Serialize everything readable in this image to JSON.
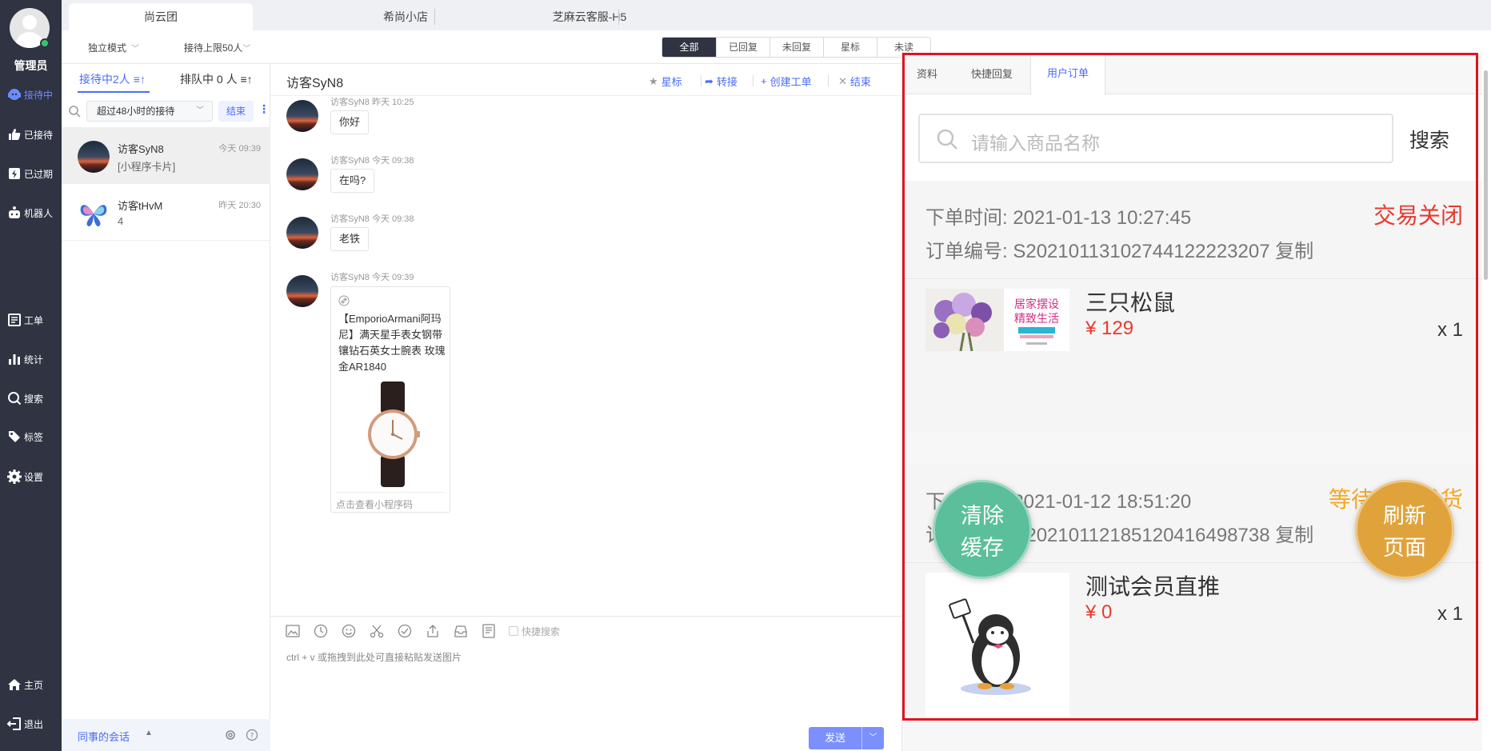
{
  "nav": {
    "user_name": "管理员",
    "items": [
      {
        "label": "接待中"
      },
      {
        "label": "已接待"
      },
      {
        "label": "已过期"
      },
      {
        "label": "机器人"
      },
      {
        "label": "工单"
      },
      {
        "label": "统计"
      },
      {
        "label": "搜索"
      },
      {
        "label": "标签"
      },
      {
        "label": "设置"
      },
      {
        "label": "主页"
      },
      {
        "label": "退出"
      }
    ]
  },
  "top_tabs": [
    "尚云团",
    "希尚小店",
    "芝麻云客服-H5"
  ],
  "mode_bar": {
    "mode": "独立模式",
    "limit": "接待上限50人",
    "filters": [
      "全部",
      "已回复",
      "未回复",
      "星标",
      "未读"
    ]
  },
  "session_list": {
    "tab_active": "接待中2人",
    "tab_queue": "排队中 0 人",
    "filter_select": "超过48小时的接待",
    "end_button": "结束",
    "more": "⋮",
    "sessions": [
      {
        "name": "访客SyN8",
        "time": "今天 09:39",
        "message": "[小程序卡片]"
      },
      {
        "name": "访客tHvM",
        "time": "昨天 20:30",
        "message": "4"
      }
    ],
    "footer_label": "同事的会话"
  },
  "chat": {
    "title": "访客SyN8",
    "actions": {
      "star": "星标",
      "transfer": "转接",
      "ticket": "创建工单",
      "end": "结束"
    },
    "messages": [
      {
        "meta": "访客SyN8   昨天 10:25",
        "text": "你好"
      },
      {
        "meta": "访客SyN8   今天 09:38",
        "text": "在吗?"
      },
      {
        "meta": "访客SyN8   今天 09:38",
        "text": "老铁"
      },
      {
        "meta": "访客SyN8   今天 09:39"
      }
    ],
    "card": {
      "text": "【EmporioArmani阿玛尼】满天星手表女钢带镶钻石英女士腕表 玫瑰金AR1840",
      "footer": "点击查看小程序码"
    },
    "quick_search": "快捷搜索",
    "hint": "ctrl + v 或拖拽到此处可直接粘贴发送图片",
    "send_label": "发送"
  },
  "right_panel": {
    "tabs": [
      "资料",
      "快捷回复",
      "用户订单"
    ],
    "search_placeholder": "请输入商品名称",
    "search_button": "搜索",
    "orders": [
      {
        "time": "下单时间: 2021-01-13 10:27:45",
        "number": "订单编号: S20210113102744122223207 复制",
        "status": "交易关闭",
        "status_color": "#e8392e",
        "product": "三只松鼠",
        "price": "¥ 129",
        "qty": "x 1",
        "image_text": [
          "居家摆设",
          "精致生活"
        ]
      },
      {
        "time": "下单时间: 2021-01-12 18:51:20",
        "number": "订单编号: S20210112185120416498738 复制",
        "status": "等待卖家发货",
        "status_color": "#f5a623",
        "product": "测试会员直推",
        "price": "¥ 0",
        "qty": "x 1"
      }
    ],
    "float_clear": [
      "清除",
      "缓存"
    ],
    "float_refresh": [
      "刷新",
      "页面"
    ]
  },
  "colors": {
    "accent": "#4a6cf7",
    "nav_bg": "#2f3342",
    "price": "#e8392e",
    "highlight_frame": "#e0141e"
  }
}
